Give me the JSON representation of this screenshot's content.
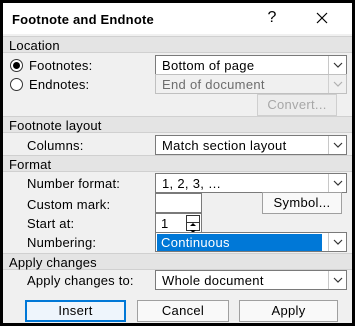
{
  "dialog": {
    "title": "Footnote and Endnote",
    "help": "?",
    "close": "✕"
  },
  "location": {
    "heading": "Location",
    "footnotes_label": "Footnotes:",
    "footnotes_value": "Bottom of page",
    "endnotes_label": "Endnotes:",
    "endnotes_value": "End of document",
    "convert": "Convert..."
  },
  "layout": {
    "heading": "Footnote layout",
    "columns_label": "Columns:",
    "columns_value": "Match section layout"
  },
  "format": {
    "heading": "Format",
    "number_format_label": "Number format:",
    "number_format_value": "1, 2, 3, …",
    "custom_mark_label": "Custom mark:",
    "custom_mark_value": "",
    "symbol": "Symbol...",
    "start_at_label": "Start at:",
    "start_at_value": "1",
    "numbering_label": "Numbering:",
    "numbering_value": "Continuous"
  },
  "apply": {
    "heading": "Apply changes",
    "apply_to_label": "Apply changes to:",
    "apply_to_value": "Whole document"
  },
  "buttons": {
    "insert": "Insert",
    "cancel": "Cancel",
    "apply": "Apply"
  },
  "colors": {
    "accent": "#0078d7"
  }
}
